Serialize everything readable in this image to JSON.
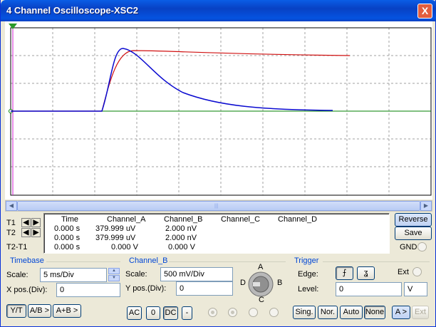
{
  "window": {
    "title": "4 Channel Oscilloscope-XSC2",
    "close": "X"
  },
  "readout": {
    "headers": [
      "Time",
      "Channel_A",
      "Channel_B",
      "Channel_C",
      "Channel_D"
    ],
    "rows": [
      {
        "label": "T1",
        "time": "0.000 s",
        "a": "379.999 uV",
        "b": "2.000 nV"
      },
      {
        "label": "T2",
        "time": "0.000 s",
        "a": "379.999 uV",
        "b": "2.000 nV"
      },
      {
        "label": "T2-T1",
        "time": "0.000 s",
        "a": "0.000 V",
        "b": "0.000 V"
      }
    ],
    "cursor_left": "◀",
    "cursor_right": "▶"
  },
  "side": {
    "reverse": "Reverse",
    "save": "Save",
    "gnd": "GND"
  },
  "timebase": {
    "title": "Timebase",
    "scale_label": "Scale:",
    "scale_value": "5 ms/Div",
    "xpos_label": "X pos.(Div):",
    "xpos_value": "0",
    "modes": [
      "Y/T",
      "A/B >",
      "A+B >"
    ]
  },
  "channel": {
    "title": "Channel_B",
    "scale_label": "Scale:",
    "scale_value": "500 mV/Div",
    "ypos_label": "Y pos.(Div):",
    "ypos_value": "0",
    "coupling": [
      "AC",
      "0",
      "DC",
      "-"
    ],
    "knob": {
      "a": "A",
      "b": "B",
      "c": "C",
      "d": "D"
    }
  },
  "trigger": {
    "title": "Trigger",
    "edge_label": "Edge:",
    "ext_label": "Ext",
    "level_label": "Level:",
    "level_value": "0",
    "level_unit": "V",
    "modes": [
      "Sing.",
      "Nor.",
      "Auto",
      "None"
    ],
    "source": [
      "A >",
      "Ext"
    ]
  },
  "traces": {
    "red_color": "#d01010",
    "blue_color": "#0a0ad0",
    "baseline_color": "#008000"
  }
}
